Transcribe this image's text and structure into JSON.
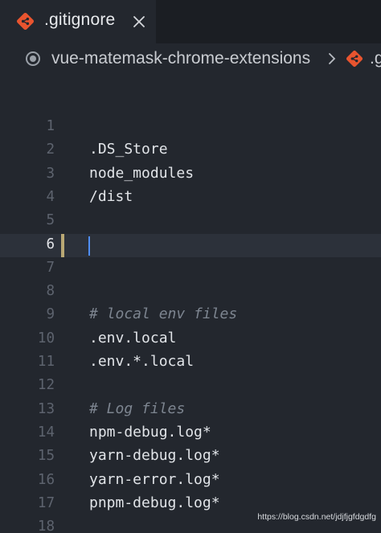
{
  "tab": {
    "label": ".gitignore",
    "icon": "git-file-icon",
    "close_icon": "close-icon"
  },
  "breadcrumb": {
    "folder": "vue-matemask-chrome-extensions",
    "separator": ">",
    "file_fragment": ".g"
  },
  "editor": {
    "active_line": 6,
    "lines": [
      {
        "number": "1",
        "text": "",
        "kind": "plain"
      },
      {
        "number": "2",
        "text": ".DS_Store",
        "kind": "plain"
      },
      {
        "number": "3",
        "text": "node_modules",
        "kind": "plain"
      },
      {
        "number": "4",
        "text": "/dist",
        "kind": "plain"
      },
      {
        "number": "5",
        "text": "",
        "kind": "plain"
      },
      {
        "number": "6",
        "text": "",
        "kind": "plain"
      },
      {
        "number": "7",
        "text": "",
        "kind": "plain"
      },
      {
        "number": "8",
        "text": "",
        "kind": "plain"
      },
      {
        "number": "9",
        "text": "# local env files",
        "kind": "comment"
      },
      {
        "number": "10",
        "text": ".env.local",
        "kind": "plain"
      },
      {
        "number": "11",
        "text": ".env.*.local",
        "kind": "plain"
      },
      {
        "number": "12",
        "text": "",
        "kind": "plain"
      },
      {
        "number": "13",
        "text": "# Log files",
        "kind": "comment"
      },
      {
        "number": "14",
        "text": "npm-debug.log*",
        "kind": "plain"
      },
      {
        "number": "15",
        "text": "yarn-debug.log*",
        "kind": "plain"
      },
      {
        "number": "16",
        "text": "yarn-error.log*",
        "kind": "plain"
      },
      {
        "number": "17",
        "text": "pnpm-debug.log*",
        "kind": "plain"
      },
      {
        "number": "18",
        "text": "",
        "kind": "plain"
      }
    ]
  },
  "watermark": "https://blog.csdn.net/jdjfjgfdgdfg",
  "colors": {
    "background": "#23272e",
    "active_line": "#2c313a",
    "git_icon": "#e8542f",
    "cursor": "#4f8ef7",
    "gutter_modified": "#b9a874",
    "comment": "#7d8590"
  }
}
